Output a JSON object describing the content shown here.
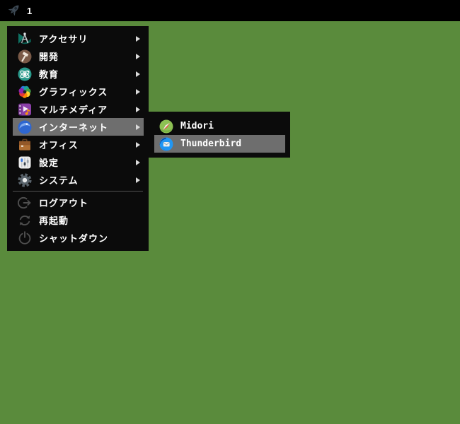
{
  "desktop": {
    "background_color": "#5a8b3c"
  },
  "taskbar": {
    "background_color": "#000000",
    "launcher_icon": "rocket-icon",
    "workspace_label": "1"
  },
  "menu": {
    "background_color": "#0b0b0b",
    "highlight_color": "#6e6e6e",
    "text_color": "#ffffff",
    "categories": [
      {
        "label": "アクセサリ",
        "icon": "accessories-icon",
        "has_submenu": true,
        "selected": false
      },
      {
        "label": "開発",
        "icon": "development-icon",
        "has_submenu": true,
        "selected": false
      },
      {
        "label": "教育",
        "icon": "education-icon",
        "has_submenu": true,
        "selected": false
      },
      {
        "label": "グラフィックス",
        "icon": "graphics-icon",
        "has_submenu": true,
        "selected": false
      },
      {
        "label": "マルチメディア",
        "icon": "multimedia-icon",
        "has_submenu": true,
        "selected": false
      },
      {
        "label": "インターネット",
        "icon": "internet-icon",
        "has_submenu": true,
        "selected": true
      },
      {
        "label": "オフィス",
        "icon": "office-icon",
        "has_submenu": true,
        "selected": false
      },
      {
        "label": "設定",
        "icon": "settings-icon",
        "has_submenu": true,
        "selected": false
      },
      {
        "label": "システム",
        "icon": "system-icon",
        "has_submenu": true,
        "selected": false
      }
    ],
    "actions": [
      {
        "label": "ログアウト",
        "icon": "logout-icon"
      },
      {
        "label": "再起動",
        "icon": "restart-icon"
      },
      {
        "label": "シャットダウン",
        "icon": "shutdown-icon"
      }
    ]
  },
  "submenu": {
    "parent": "インターネット",
    "items": [
      {
        "label": "Midori",
        "icon": "midori-icon",
        "selected": false
      },
      {
        "label": "Thunderbird",
        "icon": "thunderbird-icon",
        "selected": true
      }
    ]
  }
}
